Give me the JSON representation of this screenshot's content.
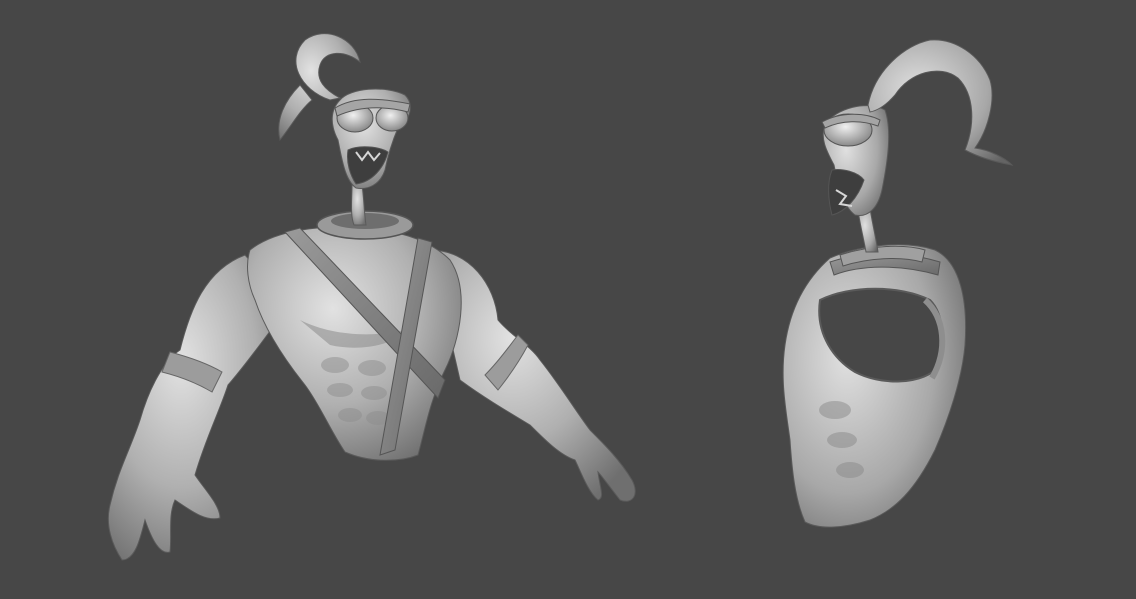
{
  "viewport": {
    "background_color": "#474747"
  },
  "render": {
    "clay_light": "#d8d8d8",
    "clay_mid": "#a9a9a9",
    "clay_dark": "#6e6e6e",
    "clay_shadow": "#4f4f4f"
  },
  "models": [
    {
      "name": "sculpt-front-three-quarter-view"
    },
    {
      "name": "sculpt-side-view"
    }
  ]
}
